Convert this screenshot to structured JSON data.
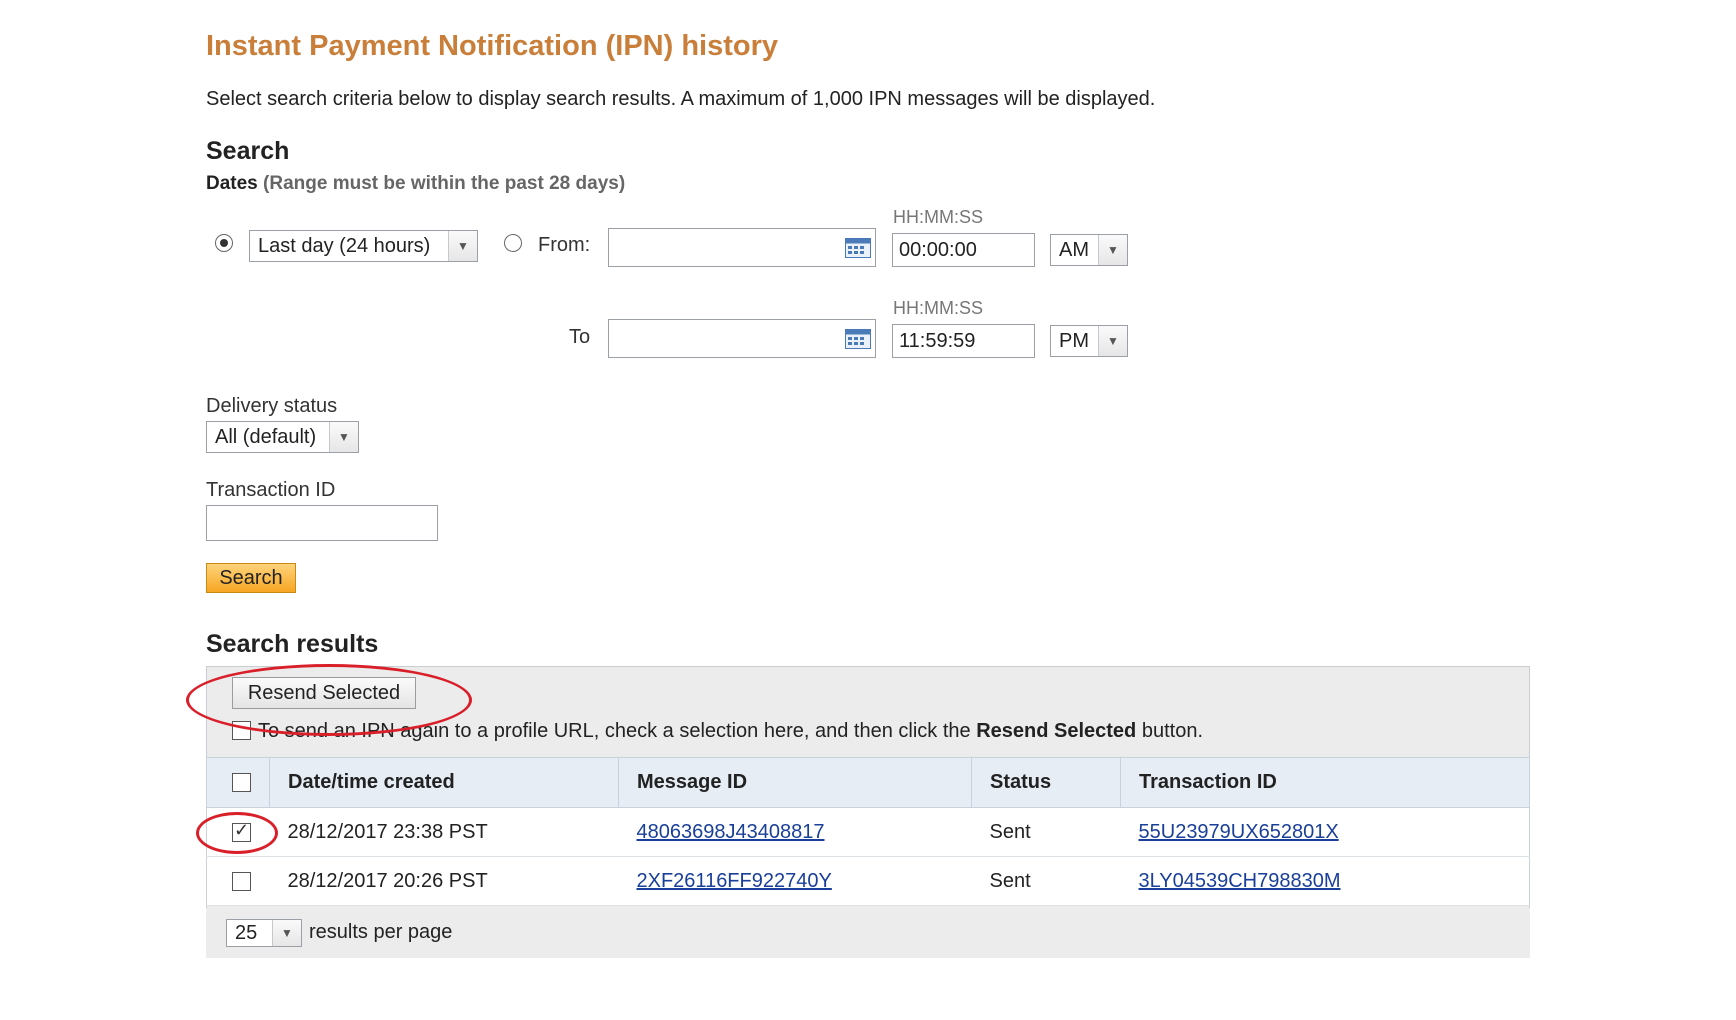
{
  "page": {
    "title": "Instant Payment Notification (IPN) history",
    "intro": "Select search criteria below to display search results. A maximum of 1,000 IPN messages will be displayed."
  },
  "search": {
    "heading": "Search",
    "dates_label": "Dates",
    "dates_note": "(Range must be within the past 28 days)",
    "range_select": "Last day (24 hours)",
    "range_selected": true,
    "from_label": "From:",
    "from_selected": false,
    "to_label": "To",
    "time_format_label": "HH:MM:SS",
    "from_date": "",
    "from_time": "00:00:00",
    "from_ampm": "AM",
    "to_date": "",
    "to_time": "11:59:59",
    "to_ampm": "PM",
    "delivery_status_label": "Delivery status",
    "delivery_status_value": "All (default)",
    "transaction_id_label": "Transaction ID",
    "transaction_id_value": "",
    "search_button": "Search"
  },
  "results": {
    "heading": "Search results",
    "resend_button": "Resend Selected",
    "hint_prefix": "To send an IPN again to a profile URL, check a selection here, and then click the ",
    "hint_bold": "Resend Selected",
    "hint_suffix": " button.",
    "columns": [
      "Date/time created",
      "Message ID",
      "Status",
      "Transaction ID"
    ],
    "rows": [
      {
        "checked": true,
        "date": "28/12/2017 23:38 PST",
        "message_id": "48063698J43408817",
        "status": "Sent",
        "transaction_id": "55U23979UX652801X"
      },
      {
        "checked": false,
        "date": "28/12/2017 20:26 PST",
        "message_id": "2XF26116FF922740Y",
        "status": "Sent",
        "transaction_id": "3LY04539CH798830M"
      }
    ],
    "per_page_value": "25",
    "per_page_label": "results per page"
  },
  "colors": {
    "title": "#c97f3a",
    "link": "#1a3f9a",
    "annotation": "#d9202a",
    "search_button": "#f6a623"
  }
}
